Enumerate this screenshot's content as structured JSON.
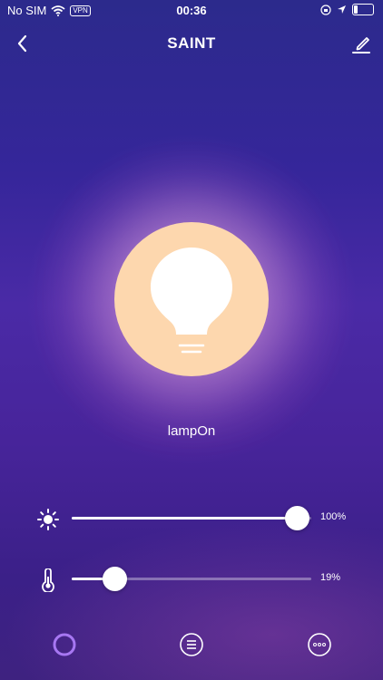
{
  "status": {
    "carrier": "No SIM",
    "vpn": "VPN",
    "time": "00:36"
  },
  "header": {
    "title": "SAINT"
  },
  "lamp": {
    "label": "lampOn",
    "bulb_color": "#fdd7ae"
  },
  "brightness": {
    "value_label": "100%",
    "level": 1.0
  },
  "temperature": {
    "value_label": "19%",
    "level": 0.19
  },
  "icons": {
    "back": "chevron-left-icon",
    "edit": "pencil-icon",
    "brightness": "sun-icon",
    "temperature": "thermometer-icon",
    "tab1": "ring-icon",
    "tab2": "list-icon",
    "tab3": "more-icon"
  }
}
